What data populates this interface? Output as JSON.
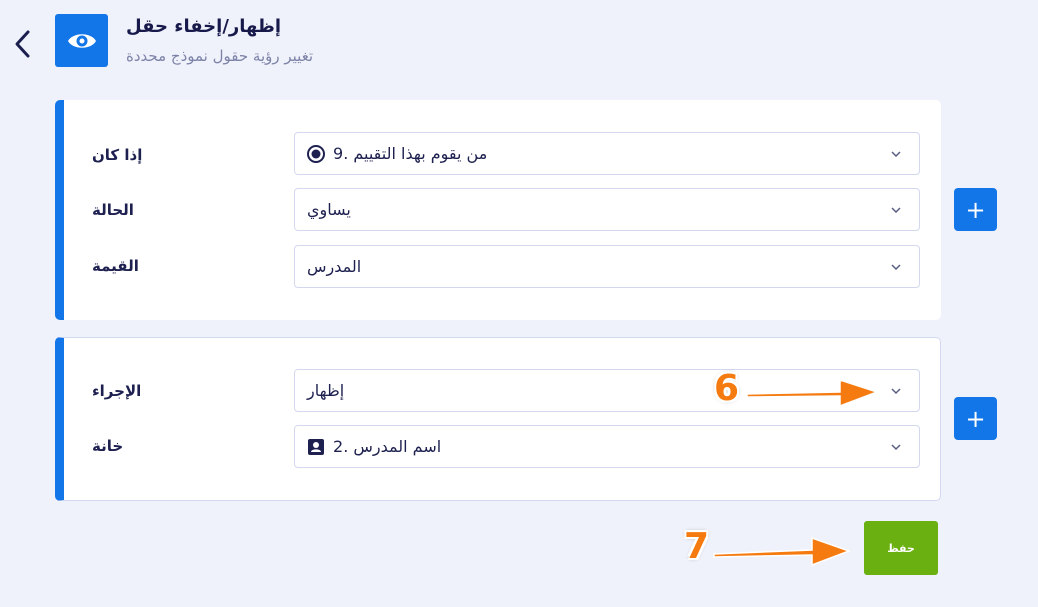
{
  "header": {
    "title": "إظهار/إخفاء حقل",
    "subtitle": "تغيير رؤية حقول نموذج محددة",
    "icon": "eye-icon"
  },
  "condition_card": {
    "rows": [
      {
        "label": "إذا كان",
        "value": "من يقوم بهذا التقييم .9",
        "icon": "radio-icon"
      },
      {
        "label": "الحالة",
        "value": "يساوي"
      },
      {
        "label": "القيمة",
        "value": "المدرس"
      }
    ]
  },
  "action_card": {
    "rows": [
      {
        "label": "الإجراء",
        "value": "إظهار"
      },
      {
        "label": "خانة",
        "value": "اسم المدرس .2",
        "icon": "contact-card-icon"
      }
    ]
  },
  "buttons": {
    "add": "+",
    "save": "حفظ"
  },
  "annotations": {
    "step6": "6",
    "step7": "7"
  },
  "colors": {
    "accent": "#1275e8",
    "save": "#6ab010",
    "annotation": "#f57b10",
    "background": "#f0f2fb"
  }
}
